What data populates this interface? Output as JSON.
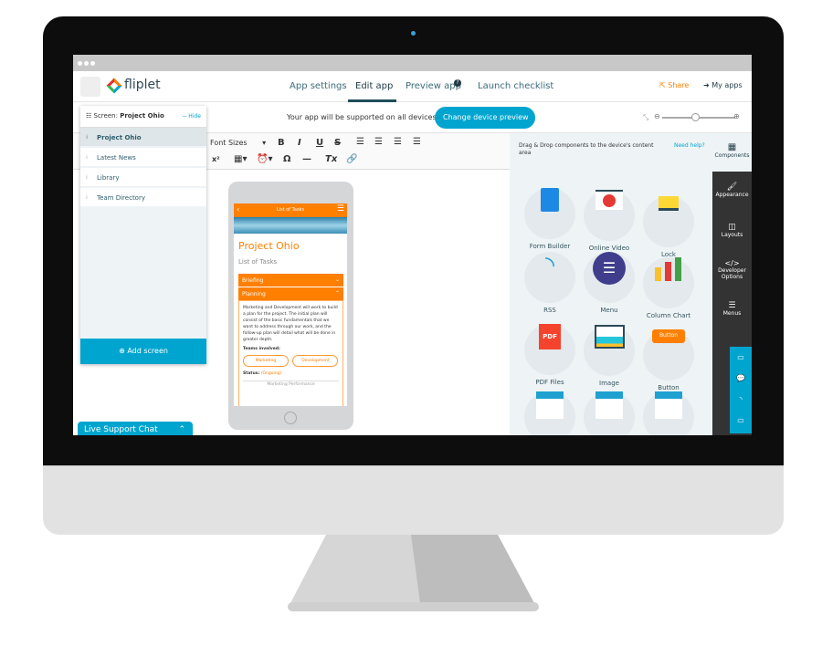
{
  "nav": {
    "logo": "fliplet",
    "links": [
      "App settings",
      "Edit app",
      "Preview app",
      "Launch checklist"
    ],
    "active": "Edit app",
    "share": "Share",
    "my_apps": "My apps"
  },
  "bar": {
    "support_text": "Your app will be supported on all devices",
    "change_device": "Change device preview"
  },
  "screens": {
    "title_prefix": "Screen:",
    "current": "Project Ohio",
    "hide": "− Hide",
    "items": [
      "Project Ohio",
      "Latest News",
      "Library",
      "Team Directory"
    ],
    "add": "Add screen"
  },
  "toolbar": {
    "font_sizes": "Font Sizes"
  },
  "phone": {
    "header": "List of Tasks",
    "title": "Project Ohio",
    "subtitle": "List of Tasks",
    "acc1": "Briefing",
    "acc2": "Planning",
    "body": "Marketing and Development will work to build a plan for the project. The initial plan will consist of the basic fundamentals that we want to address through our work, and the follow-up plan will detail what will be done in greater depth.",
    "teams_label": "Teams involved:",
    "team1": "Marketing",
    "team2": "Development",
    "status_label": "Status:",
    "status": "(Ongoing)",
    "footer": "Marketing Performance"
  },
  "components": {
    "hint": "Drag & Drop components to the device's content area",
    "help": "Need help?",
    "tab": "Components",
    "items": [
      "Form Builder",
      "Online Video",
      "Lock",
      "RSS",
      "Menu",
      "Column Chart",
      "PDF Files",
      "Image",
      "Button"
    ],
    "button_icon_text": "Button",
    "pdf_icon_text": "PDF"
  },
  "sidebar": [
    "Appearance",
    "Layouts",
    "Developer Options",
    "Menus"
  ],
  "chat": "Live Support Chat",
  "colors": {
    "accent": "#00a5cf",
    "orange": "#ff7f00",
    "dark": "#333333"
  }
}
